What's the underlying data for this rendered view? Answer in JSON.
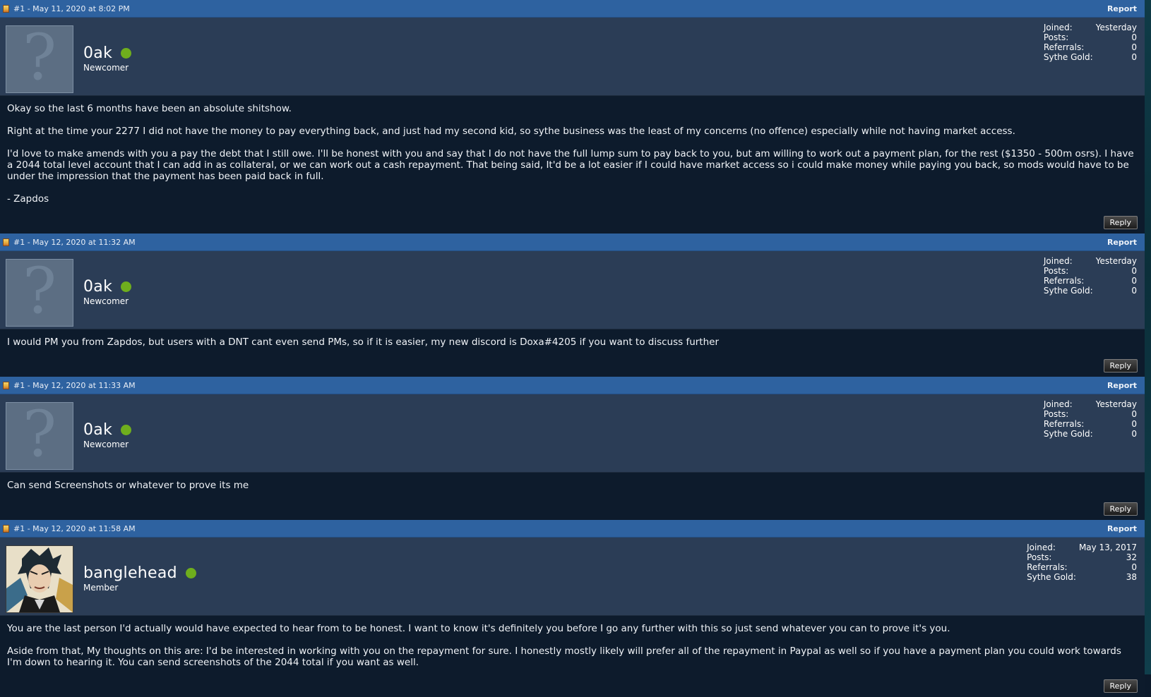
{
  "posts": [
    {
      "meta": "#1 - May 11, 2020 at 8:02 PM",
      "report_label": "Report",
      "username": "0ak",
      "rank": "Newcomer",
      "avatar": "default-avatar",
      "stats": [
        {
          "label": "Joined:",
          "value": "Yesterday"
        },
        {
          "label": "Posts:",
          "value": "0"
        },
        {
          "label": "Referrals:",
          "value": "0"
        },
        {
          "label": "Sythe Gold:",
          "value": "0"
        }
      ],
      "body": [
        "Okay so the last 6 months have been an absolute shitshow.",
        "Right at the time your 2277 I did not have the money to pay everything back, and just had my second kid, so sythe business was the least of my concerns (no offence) especially while not having market access.",
        "I'd love to make amends with you a pay the debt that I still owe. I'll be honest with you and say that I do not have the full lump sum to pay back to you, but am willing to work out a payment plan, for the rest ($1350 - 500m osrs). I have a 2044 total level account that I can add in as collateral, or we can work out a cash repayment. That being said, It'd be a lot easier if I could have market access so i could make money while paying you back, so mods would have to be under the impression that the payment has been paid back in full.",
        "- Zapdos"
      ],
      "reply_label": "Reply"
    },
    {
      "meta": "#1 - May 12, 2020 at 11:32 AM",
      "report_label": "Report",
      "username": "0ak",
      "rank": "Newcomer",
      "avatar": "default-avatar",
      "stats": [
        {
          "label": "Joined:",
          "value": "Yesterday"
        },
        {
          "label": "Posts:",
          "value": "0"
        },
        {
          "label": "Referrals:",
          "value": "0"
        },
        {
          "label": "Sythe Gold:",
          "value": "0"
        }
      ],
      "body": [
        "I would PM you from Zapdos, but users with a DNT cant even send PMs, so if it is easier, my new discord is Doxa#4205 if you want to discuss further"
      ],
      "reply_label": "Reply"
    },
    {
      "meta": "#1 - May 12, 2020 at 11:33 AM",
      "report_label": "Report",
      "username": "0ak",
      "rank": "Newcomer",
      "avatar": "default-avatar",
      "stats": [
        {
          "label": "Joined:",
          "value": "Yesterday"
        },
        {
          "label": "Posts:",
          "value": "0"
        },
        {
          "label": "Referrals:",
          "value": "0"
        },
        {
          "label": "Sythe Gold:",
          "value": "0"
        }
      ],
      "body": [
        "Can send Screenshots or whatever to prove its me"
      ],
      "reply_label": "Reply"
    },
    {
      "meta": "#1 - May 12, 2020 at 11:58 AM",
      "report_label": "Report",
      "username": "banglehead",
      "rank": "Member",
      "avatar": "custom-avatar",
      "stats": [
        {
          "label": "Joined:",
          "value": "May 13, 2017"
        },
        {
          "label": "Posts:",
          "value": "32"
        },
        {
          "label": "Referrals:",
          "value": "0"
        },
        {
          "label": "Sythe Gold:",
          "value": "38"
        }
      ],
      "body": [
        "You are the last person I'd actually would have expected to hear from to be honest. I want to know it's definitely you before I go any further with this so just send whatever you can to prove it's you.",
        "Aside from that, My thoughts on this are: I'd be interested in working with you on the repayment for sure. I honestly mostly likely will prefer all of the repayment in Paypal as well so if you have a payment plan you could work towards I'm down to hearing it. You can send screenshots of the 2044 total if you want as well."
      ],
      "reply_label": "Reply"
    }
  ]
}
